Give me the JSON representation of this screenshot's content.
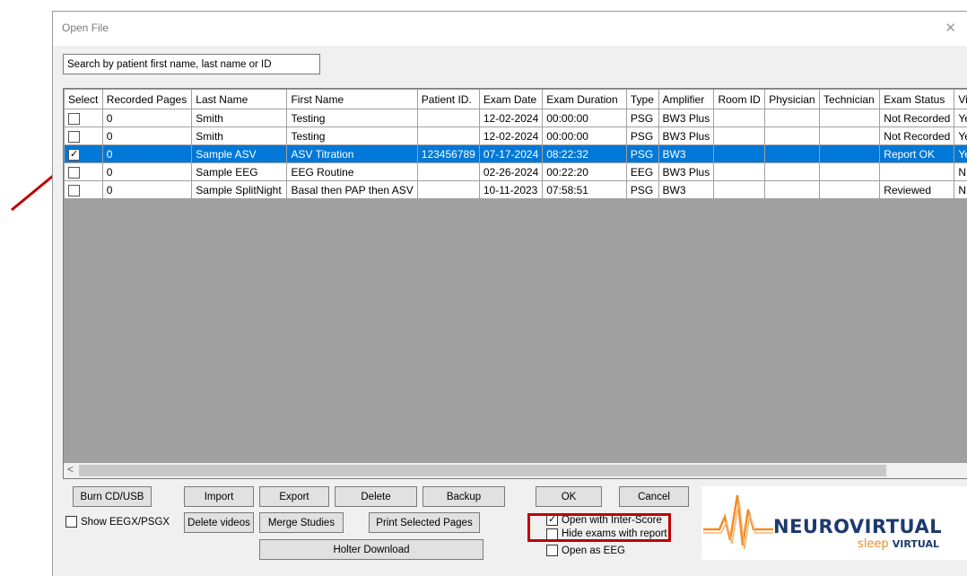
{
  "dialog": {
    "title": "Open File",
    "close_glyph": "✕"
  },
  "search": {
    "placeholder": "Search by patient first name, last name or ID"
  },
  "table": {
    "columns": [
      "Select",
      "Recorded Pages",
      "Last Name",
      "First Name",
      "Patient ID.",
      "Exam Date",
      "Exam Duration",
      "Type",
      "Amplifier",
      "Room ID",
      "Physician",
      "Technician",
      "Exam Status",
      "Vi"
    ],
    "rows": [
      {
        "selected": false,
        "checked": false,
        "cells": [
          "0",
          "Smith",
          "Testing",
          "",
          "12-02-2024",
          "00:00:00",
          "PSG",
          "BW3 Plus",
          "",
          "",
          "",
          "Not Recorded",
          "Ye"
        ]
      },
      {
        "selected": false,
        "checked": false,
        "cells": [
          "0",
          "Smith",
          "Testing",
          "",
          "12-02-2024",
          "00:00:00",
          "PSG",
          "BW3 Plus",
          "",
          "",
          "",
          "Not Recorded",
          "Ye"
        ]
      },
      {
        "selected": true,
        "checked": true,
        "cells": [
          "0",
          "Sample ASV",
          "ASV Titration",
          "123456789",
          "07-17-2024",
          "08:22:32",
          "PSG",
          "BW3",
          "",
          "",
          "",
          "Report OK",
          "Ye"
        ]
      },
      {
        "selected": false,
        "checked": false,
        "cells": [
          "0",
          "Sample EEG",
          "EEG Routine",
          "",
          "02-26-2024",
          "00:22:20",
          "EEG",
          "BW3 Plus",
          "",
          "",
          "",
          "",
          "N"
        ]
      },
      {
        "selected": false,
        "checked": false,
        "cells": [
          "0",
          "Sample SplitNight",
          "Basal then PAP then ASV",
          "",
          "10-11-2023",
          "07:58:51",
          "PSG",
          "BW3",
          "",
          "",
          "",
          "Reviewed",
          "N"
        ]
      }
    ]
  },
  "scroll": {
    "left": "<",
    "right": ">"
  },
  "buttons": {
    "burn": "Burn CD/USB",
    "import": "Import",
    "export": "Export",
    "delete": "Delete",
    "backup": "Backup",
    "ok": "OK",
    "cancel": "Cancel",
    "delete_videos": "Delete videos",
    "merge": "Merge Studies",
    "print": "Print Selected Pages",
    "holter": "Holter Download"
  },
  "options": {
    "show_eegx": {
      "label": "Show EEGX/PSGX",
      "checked": false
    },
    "inter_score": {
      "label": "Open with Inter-Score",
      "checked": true
    },
    "hide_exams": {
      "label": "Hide exams with report",
      "checked": false
    },
    "open_eeg": {
      "label": "Open as EEG",
      "checked": false
    }
  },
  "logo": {
    "brand": "NEUROVIRTUAL",
    "sub1": "sleep",
    "sub2": "VIRTUAL"
  },
  "colors": {
    "selection": "#0078d7",
    "annotation": "#c00000",
    "logo_blue": "#1c3a6e",
    "logo_orange": "#f28c28"
  }
}
